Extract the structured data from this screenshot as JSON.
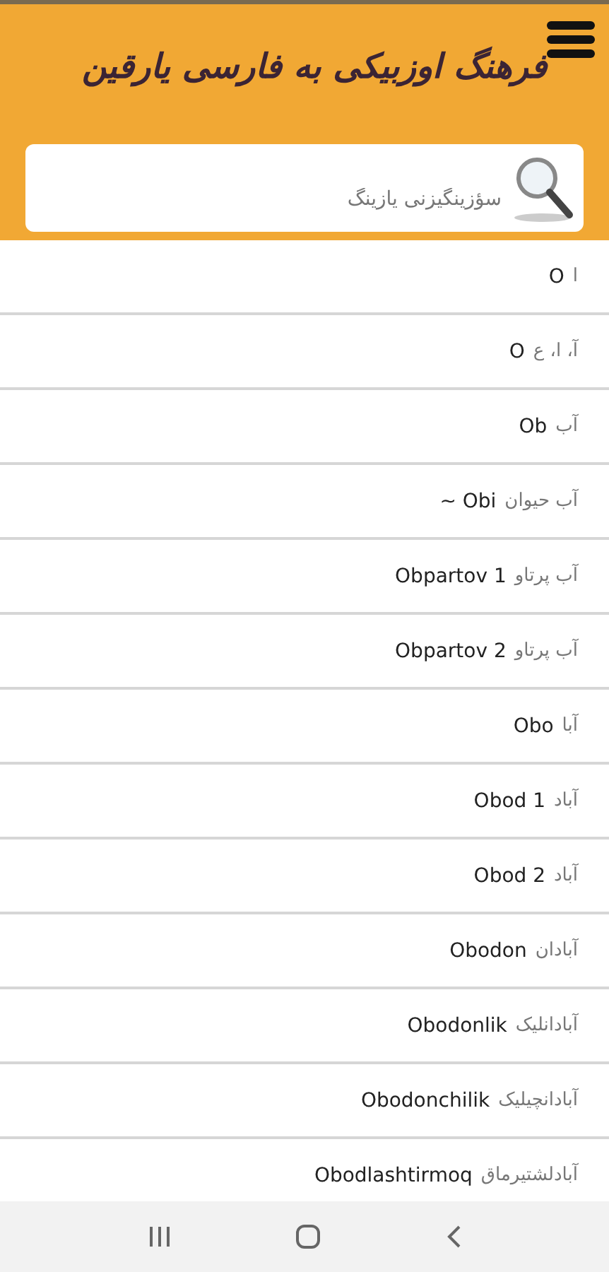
{
  "header": {
    "title": "فرهنگ اوزبیکی به فارسی یارقین"
  },
  "search": {
    "placeholder": "سؤزینگیزنی یازینگ"
  },
  "entries": [
    {
      "persian": "ا",
      "headword": "O"
    },
    {
      "persian": "آ، ا، ع",
      "headword": "O"
    },
    {
      "persian": "آب",
      "headword": "Ob"
    },
    {
      "persian": "آب حیوان",
      "headword": "~ Obi"
    },
    {
      "persian": "آب پرتاو",
      "headword": "Obpartov 1"
    },
    {
      "persian": "آب پرتاو",
      "headword": "Obpartov 2"
    },
    {
      "persian": "آبا",
      "headword": "Obo"
    },
    {
      "persian": "آباد",
      "headword": "Obod 1"
    },
    {
      "persian": "آباد",
      "headword": "Obod 2"
    },
    {
      "persian": "آبادان",
      "headword": "Obodon"
    },
    {
      "persian": "آبادانلیک",
      "headword": "Obodonlik"
    },
    {
      "persian": "آبادانچیلیک",
      "headword": "Obodonchilik"
    },
    {
      "persian": "آبادلشتیرماق",
      "headword": "Obodlashtirmoq"
    }
  ]
}
